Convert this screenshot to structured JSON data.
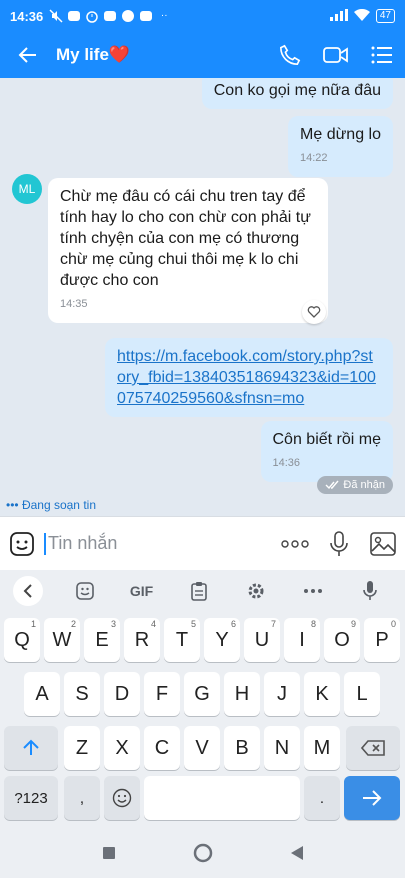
{
  "status_bar": {
    "time": "14:36",
    "app_icons": [
      "mute",
      "zalo",
      "alarm",
      "zalo",
      "facebook",
      "zalo",
      "more"
    ],
    "battery": "47"
  },
  "header": {
    "title": "My life",
    "title_emoji": "❤️"
  },
  "messages": [
    {
      "sender": "me",
      "text": "Con ko gọi mẹ nữa đâu",
      "time": ""
    },
    {
      "sender": "me",
      "text": "Mẹ dừng lo",
      "time": "14:22"
    },
    {
      "sender": "other",
      "avatar": "ML",
      "text": "Chừ mẹ đâu có cái chu tren tay để tính hay lo cho con chừ con phải tự tính chyện của con  mẹ có thương chừ mẹ củng chui thôi mẹ k lo chi được cho con",
      "time": "14:35"
    },
    {
      "sender": "me",
      "link": "https://m.facebook.com/story.php?story_fbid=138403518694323&id=100075740259560&sfnsn=mo",
      "time": ""
    },
    {
      "sender": "me",
      "text": "Côn biết rồi mẹ",
      "time": "14:36"
    }
  ],
  "delivery_status": "Đã nhận",
  "typing_indicator": "Đang soạn tin",
  "composer": {
    "placeholder": "Tin nhắn"
  },
  "keyboard": {
    "tools": [
      "back",
      "sticker",
      "GIF",
      "clipboard",
      "settings",
      "more",
      "mic"
    ],
    "row1": [
      [
        "Q",
        "1"
      ],
      [
        "W",
        "2"
      ],
      [
        "E",
        "3"
      ],
      [
        "R",
        "4"
      ],
      [
        "T",
        "5"
      ],
      [
        "Y",
        "6"
      ],
      [
        "U",
        "7"
      ],
      [
        "I",
        "8"
      ],
      [
        "O",
        "9"
      ],
      [
        "P",
        "0"
      ]
    ],
    "row2": [
      "A",
      "S",
      "D",
      "F",
      "G",
      "H",
      "J",
      "K",
      "L"
    ],
    "row3": [
      "Z",
      "X",
      "C",
      "V",
      "B",
      "N",
      "M"
    ],
    "symbols": "?123",
    "comma": ",",
    "period": "."
  },
  "colors": {
    "header": "#1a8cff",
    "my_bubble": "#d6ebfd",
    "other_bubble": "#ffffff",
    "chat_bg": "#e2e9f1",
    "link": "#1a73c9",
    "avatar": "#22c6d3"
  }
}
